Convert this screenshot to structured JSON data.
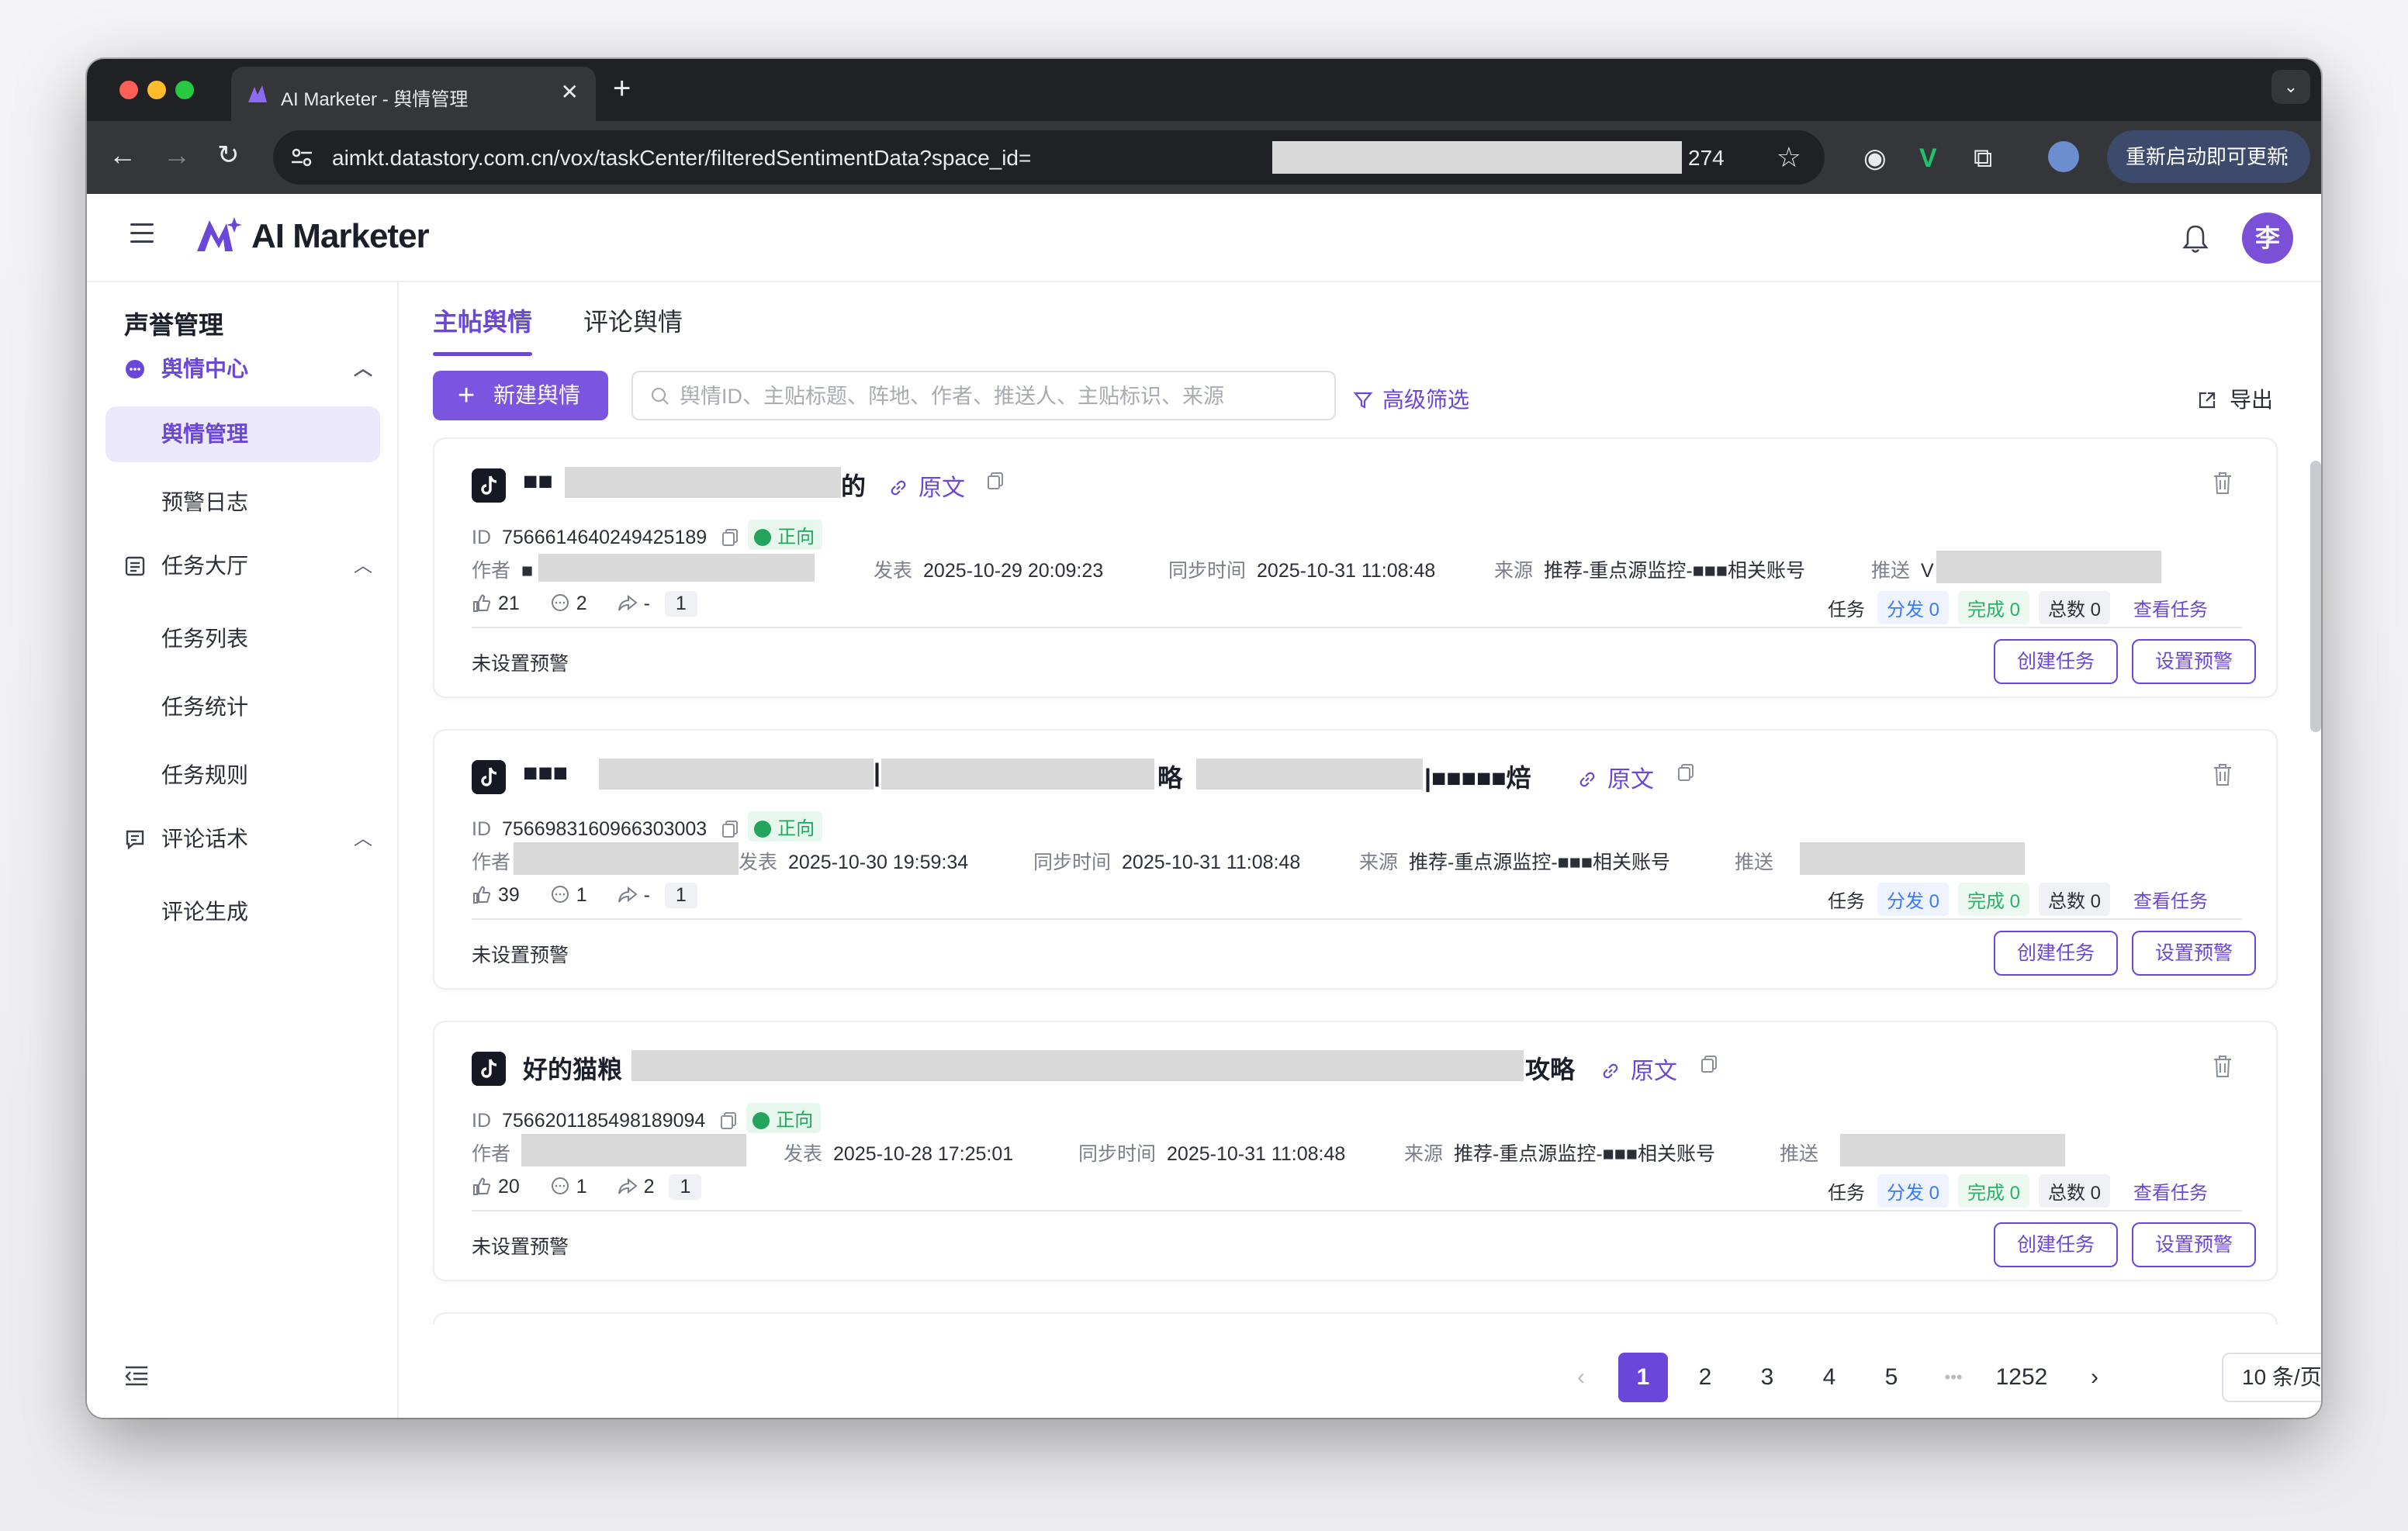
{
  "browser": {
    "tab_title": "AI Marketer - 舆情管理",
    "tab_close": "✕",
    "new_tab": "+",
    "tab_menu": "⌄",
    "url_prefix": "aimkt.datastory.com.cn/vox/taskCenter/filteredSentimentData?space_id=",
    "url_suffix": "274",
    "update_button": "重新启动即可更新"
  },
  "app": {
    "brand": "AI Marketer",
    "avatar_initial": "李",
    "accent": "#6a47d8"
  },
  "sidebar": {
    "title": "声誉管理",
    "groups": [
      {
        "label": "舆情中心",
        "items": [
          {
            "label": "舆情管理",
            "active": true
          },
          {
            "label": "预警日志"
          }
        ]
      },
      {
        "label": "任务大厅",
        "items": [
          {
            "label": "任务列表"
          },
          {
            "label": "任务统计"
          },
          {
            "label": "任务规则"
          }
        ]
      },
      {
        "label": "评论话术",
        "items": [
          {
            "label": "评论生成"
          }
        ]
      }
    ]
  },
  "main": {
    "tabs": [
      "主帖舆情",
      "评论舆情"
    ],
    "new_button": "新建舆情",
    "search_placeholder": "舆情ID、主贴标题、阵地、作者、推送人、主贴标识、来源",
    "filter_label": "高级筛选",
    "export_label": "导出"
  },
  "labels": {
    "orig": "原文",
    "id": "ID",
    "positive": "正向",
    "author": "作者",
    "post": "发表",
    "sync": "同步时间",
    "source": "来源",
    "push": "推送",
    "task": "任务",
    "dist": "分发 0",
    "done": "完成 0",
    "total": "总数 0",
    "view_task": "查看任务",
    "no_warning": "未设置预警",
    "create_task": "创建任务",
    "set_warning": "设置预警"
  },
  "posts": [
    {
      "title_start": "■■",
      "title_end": "的",
      "id": "7566614640249425189",
      "author_visible": "■",
      "post_time": "2025-10-29 20:09:23",
      "sync_time": "2025-10-31 11:08:48",
      "source": "推荐-重点源监控-■■■相关账号",
      "push_visible": "V",
      "likes": "21",
      "comments": "2",
      "shares": "-",
      "count": "1"
    },
    {
      "title_start": "■■■",
      "title_mid1": "|",
      "title_mid2": "略",
      "title_end": "|■■■■■焙",
      "id": "7566983160966303003",
      "author_visible": "",
      "post_time": "2025-10-30 19:59:34",
      "sync_time": "2025-10-31 11:08:48",
      "source": "推荐-重点源监控-■■■相关账号",
      "push_visible": "",
      "likes": "39",
      "comments": "1",
      "shares": "-",
      "count": "1"
    },
    {
      "title_start": "好的猫粮",
      "title_end": "攻略",
      "id": "7566201185498189094",
      "author_visible": "",
      "post_time": "2025-10-28 17:25:01",
      "sync_time": "2025-10-31 11:08:48",
      "source": "推荐-重点源监控-■■■相关账号",
      "push_visible": "",
      "likes": "20",
      "comments": "1",
      "shares": "2",
      "count": "1"
    }
  ],
  "pagination": {
    "pages": [
      "1",
      "2",
      "3",
      "4",
      "5"
    ],
    "ellipsis": "•••",
    "last": "1252",
    "current": "1",
    "page_size": "10 条/页"
  }
}
